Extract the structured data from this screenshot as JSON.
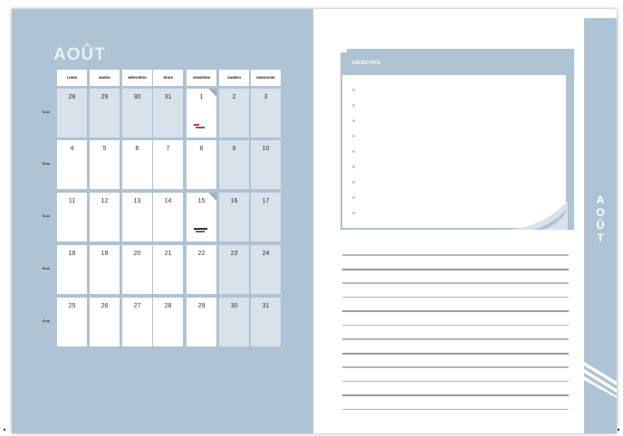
{
  "month": "AOÛT",
  "weekdays": [
    "LUNDI",
    "MARDI",
    "MERCREDI",
    "JEUDI",
    "VENDREDI",
    "SAMEDI",
    "DIMANCHE"
  ],
  "week_label": "S.xx",
  "weeks": [
    [
      "28",
      "29",
      "30",
      "31",
      "1",
      "2",
      "3"
    ],
    [
      "4",
      "5",
      "6",
      "7",
      "8",
      "9",
      "10"
    ],
    [
      "11",
      "12",
      "13",
      "14",
      "15",
      "16",
      "17"
    ],
    [
      "18",
      "19",
      "20",
      "21",
      "22",
      "23",
      "24"
    ],
    [
      "25",
      "26",
      "27",
      "28",
      "29",
      "30",
      "31"
    ]
  ],
  "objectives_title": "OBJECTIFS",
  "side_tab_text": "AOÛT",
  "colors": {
    "page": "#aec3d3",
    "cell": "#ffffff",
    "weekend": "#d8e2ea",
    "accent": "#9fb3c2"
  }
}
